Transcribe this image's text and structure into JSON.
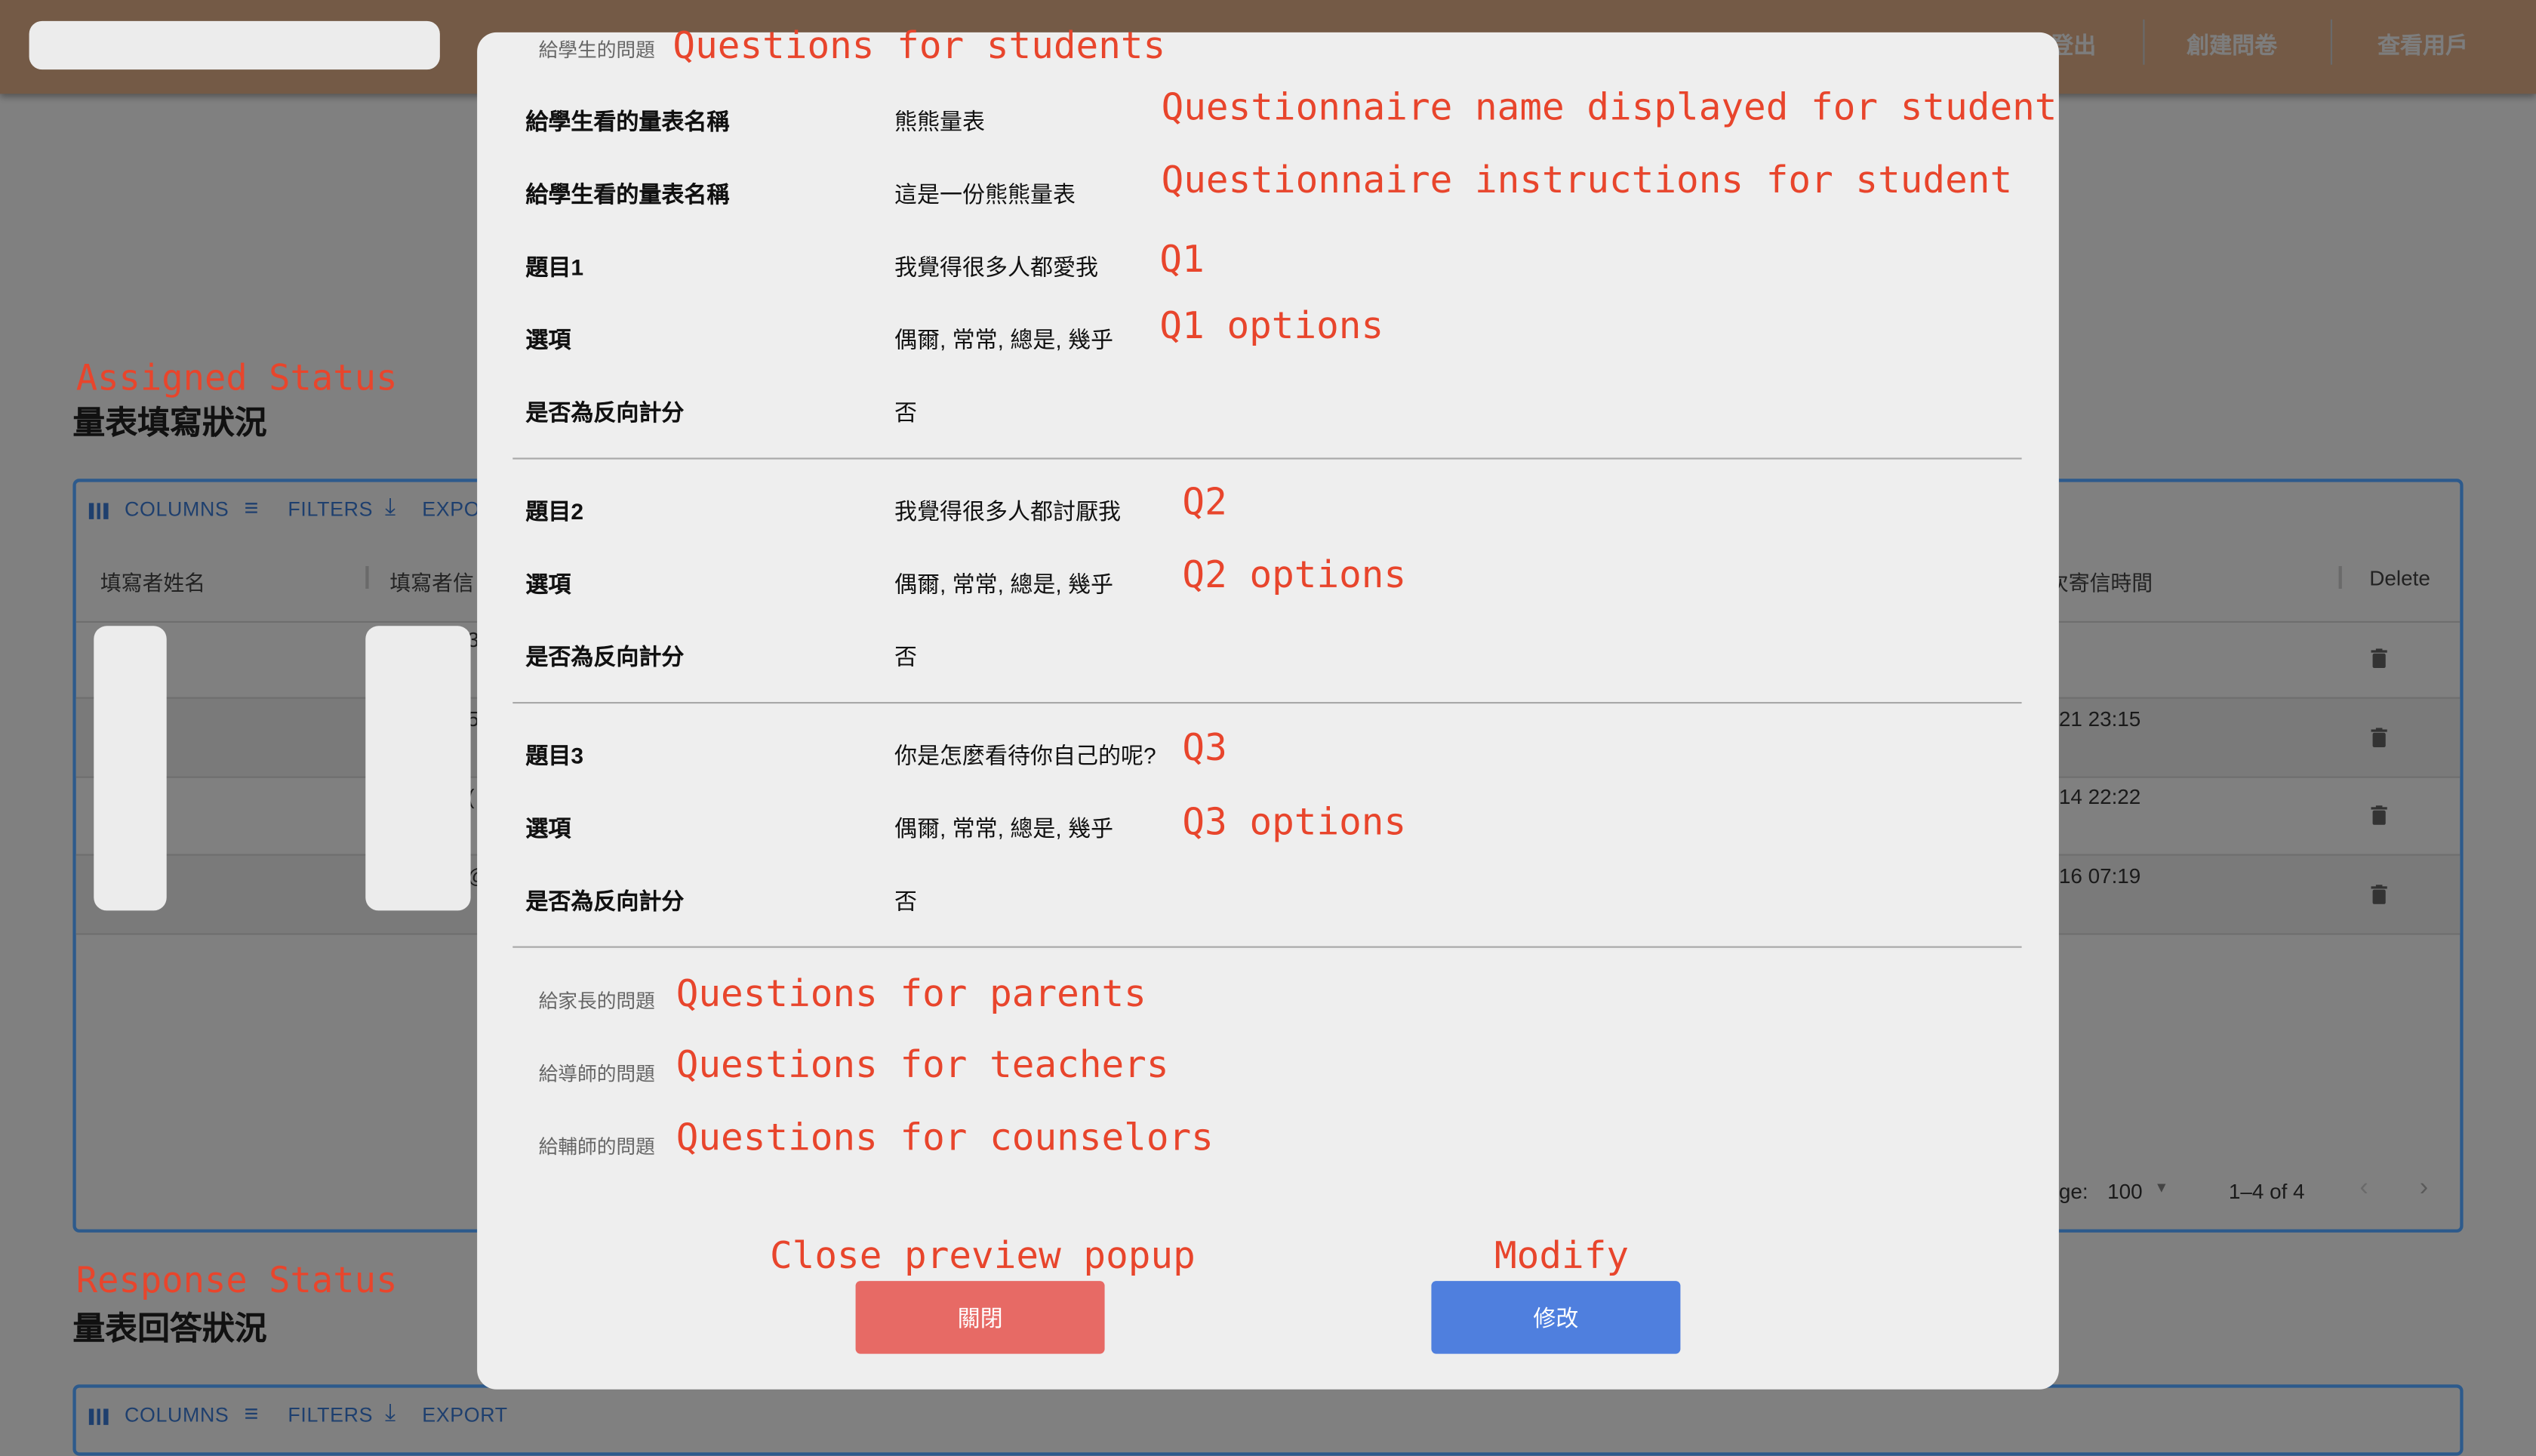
{
  "header": {
    "nav": [
      "登出",
      "創建問卷",
      "查看用戶"
    ],
    "color": "#745a46"
  },
  "assigned": {
    "annotation": "Assigned Status",
    "title": "量表填寫狀況",
    "toolbar": {
      "columns": "COLUMNS",
      "filters": "FILTERS",
      "export": "EXPO"
    },
    "columns": [
      "填寫者姓名",
      "填寫者信",
      "次寄信時間",
      "Delete"
    ],
    "rows": [
      {
        "partial": "3",
        "time": ""
      },
      {
        "partial": "5",
        "time": "21 23:15"
      },
      {
        "partial": "(",
        "time": "14 22:22"
      },
      {
        "partial": "@",
        "time": "16 07:19"
      }
    ],
    "pagination": {
      "rows_label": "ge:",
      "rows_per_page": "100",
      "range": "1–4 of 4"
    }
  },
  "response": {
    "annotation": "Response Status",
    "title": "量表回答狀況",
    "toolbar": {
      "columns": "COLUMNS",
      "filters": "FILTERS",
      "export": "EXPORT"
    }
  },
  "modal": {
    "student_section": {
      "label": "給學生的問題",
      "annotation": "Questions for students"
    },
    "fields": [
      {
        "label": "給學生看的量表名稱",
        "value": "熊熊量表",
        "annotation": "Questionnaire name displayed for student"
      },
      {
        "label": "給學生看的量表名稱",
        "value": "這是一份熊熊量表",
        "annotation": "Questionnaire instructions for student"
      }
    ],
    "questions": [
      {
        "label": "題目1",
        "text": "我覺得很多人都愛我",
        "annotation": "Q1",
        "options_label": "選項",
        "options": "偶爾, 常常, 總是, 幾乎",
        "options_annotation": "Q1 options",
        "reverse_label": "是否為反向計分",
        "reverse": "否"
      },
      {
        "label": "題目2",
        "text": "我覺得很多人都討厭我",
        "annotation": "Q2",
        "options_label": "選項",
        "options": "偶爾, 常常, 總是, 幾乎",
        "options_annotation": "Q2 options",
        "reverse_label": "是否為反向計分",
        "reverse": "否"
      },
      {
        "label": "題目3",
        "text": "你是怎麼看待你自己的呢?",
        "annotation": "Q3",
        "options_label": "選項",
        "options": "偶爾, 常常, 總是, 幾乎",
        "options_annotation": "Q3 options",
        "reverse_label": "是否為反向計分",
        "reverse": "否"
      }
    ],
    "other_sections": [
      {
        "label": "給家長的問題",
        "annotation": "Questions for parents"
      },
      {
        "label": "給導師的問題",
        "annotation": "Questions for teachers"
      },
      {
        "label": "給輔師的問題",
        "annotation": "Questions for counselors"
      }
    ],
    "close_button": {
      "label": "關閉",
      "annotation": "Close preview popup",
      "color": "#e76a65"
    },
    "modify_button": {
      "label": "修改",
      "annotation": "Modify",
      "color": "#4f7fde"
    }
  }
}
